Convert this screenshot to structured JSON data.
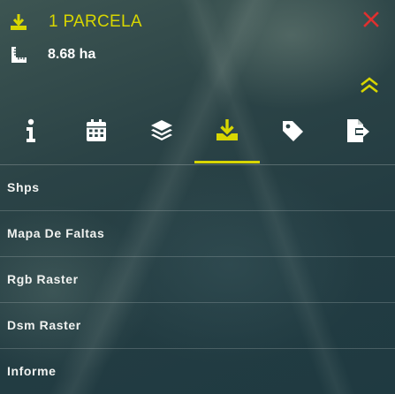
{
  "header": {
    "title": "1 PARCELA",
    "title_icon": "download-icon",
    "area": "8.68 ha",
    "area_icon": "ruler-icon",
    "close_icon": "close-icon",
    "collapse_icon": "double-chevron-up-icon"
  },
  "tabs": [
    {
      "icon": "info-icon",
      "active": false
    },
    {
      "icon": "calendar-icon",
      "active": false
    },
    {
      "icon": "layers-icon",
      "active": false
    },
    {
      "icon": "download-icon",
      "active": true
    },
    {
      "icon": "tag-icon",
      "active": false
    },
    {
      "icon": "file-export-icon",
      "active": false
    }
  ],
  "downloads": {
    "items": [
      {
        "label": "Shps"
      },
      {
        "label": "Mapa De Faltas"
      },
      {
        "label": "Rgb Raster"
      },
      {
        "label": "Dsm Raster"
      },
      {
        "label": "Informe"
      }
    ]
  },
  "colors": {
    "accent": "#d8d600",
    "close": "#e0302f",
    "text": "#ffffff"
  }
}
